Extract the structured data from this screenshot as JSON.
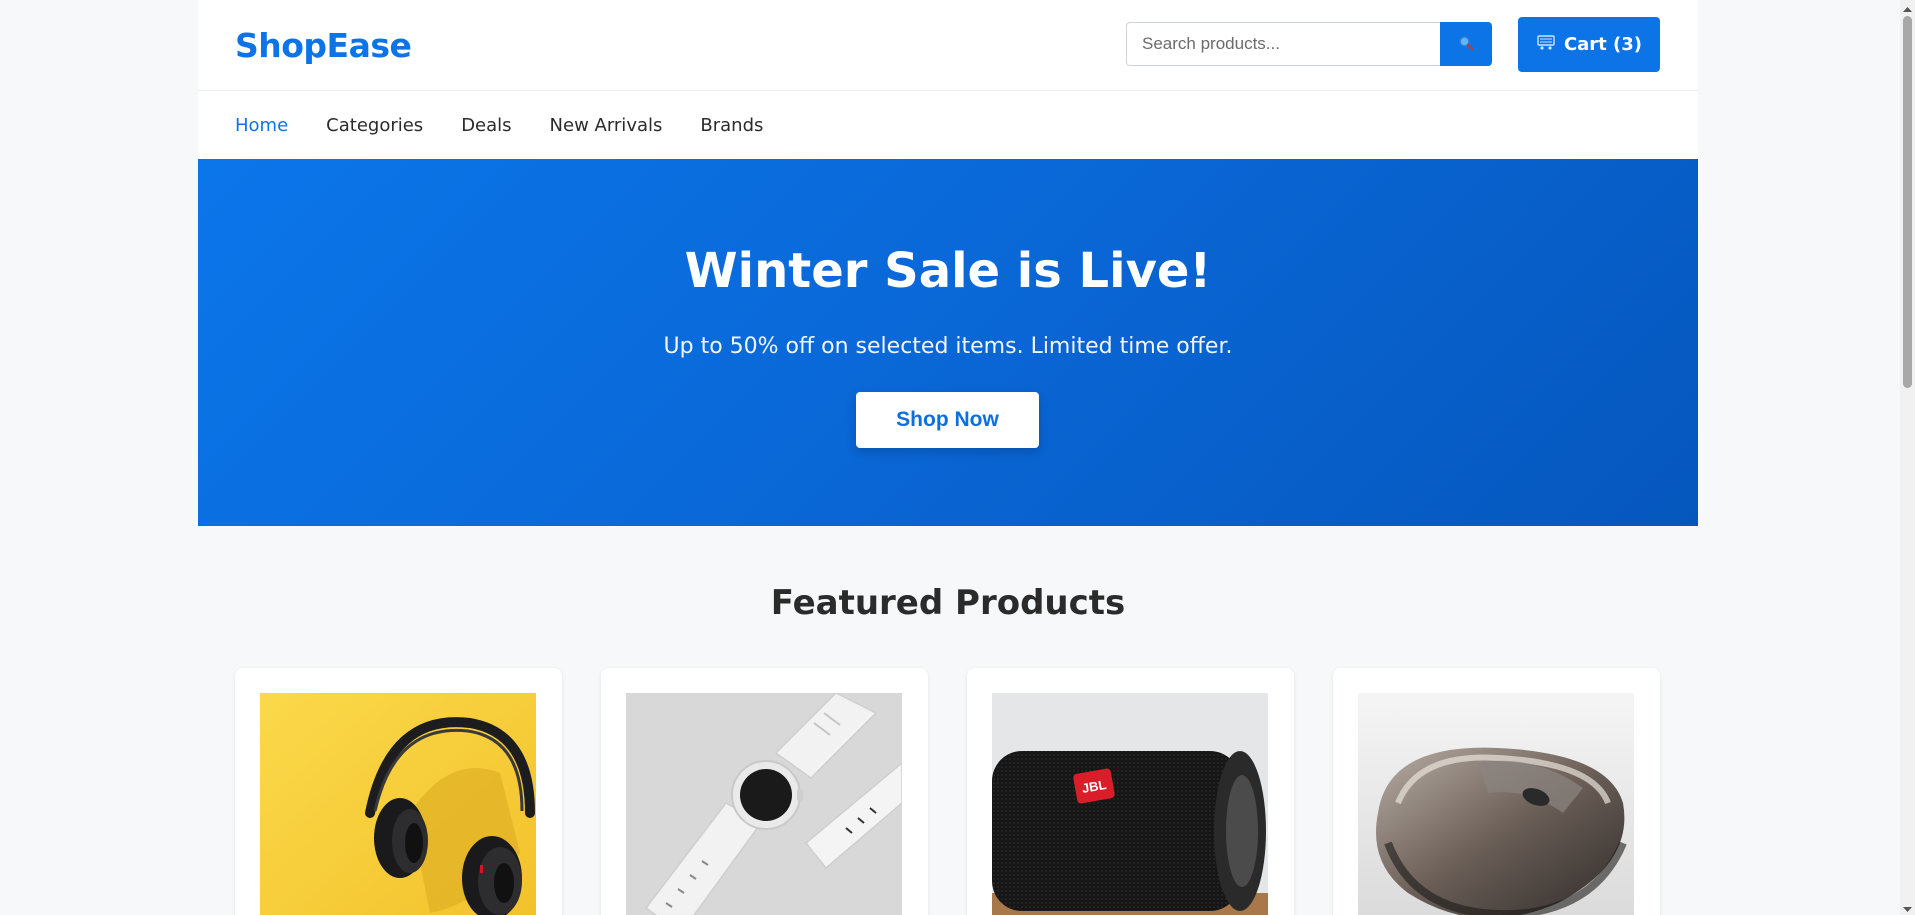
{
  "brand": {
    "name": "ShopEase"
  },
  "search": {
    "placeholder": "Search products..."
  },
  "cart": {
    "label": "Cart (3)"
  },
  "nav": {
    "items": [
      {
        "label": "Home",
        "active": true
      },
      {
        "label": "Categories"
      },
      {
        "label": "Deals"
      },
      {
        "label": "New Arrivals"
      },
      {
        "label": "Brands"
      }
    ]
  },
  "hero": {
    "title": "Winter Sale is Live!",
    "subtitle": "Up to 50% off on selected items. Limited time offer.",
    "cta": "Shop Now"
  },
  "featured": {
    "title": "Featured Products",
    "products": [
      {
        "image": "headphones-image"
      },
      {
        "image": "smartwatch-image"
      },
      {
        "image": "speaker-image",
        "logo_text": "JBL"
      },
      {
        "image": "mouse-image"
      }
    ]
  },
  "colors": {
    "accent": "#0d74e7",
    "hero_start": "#0b76ea",
    "hero_end": "#0557bd",
    "background": "#f7f8f9"
  }
}
